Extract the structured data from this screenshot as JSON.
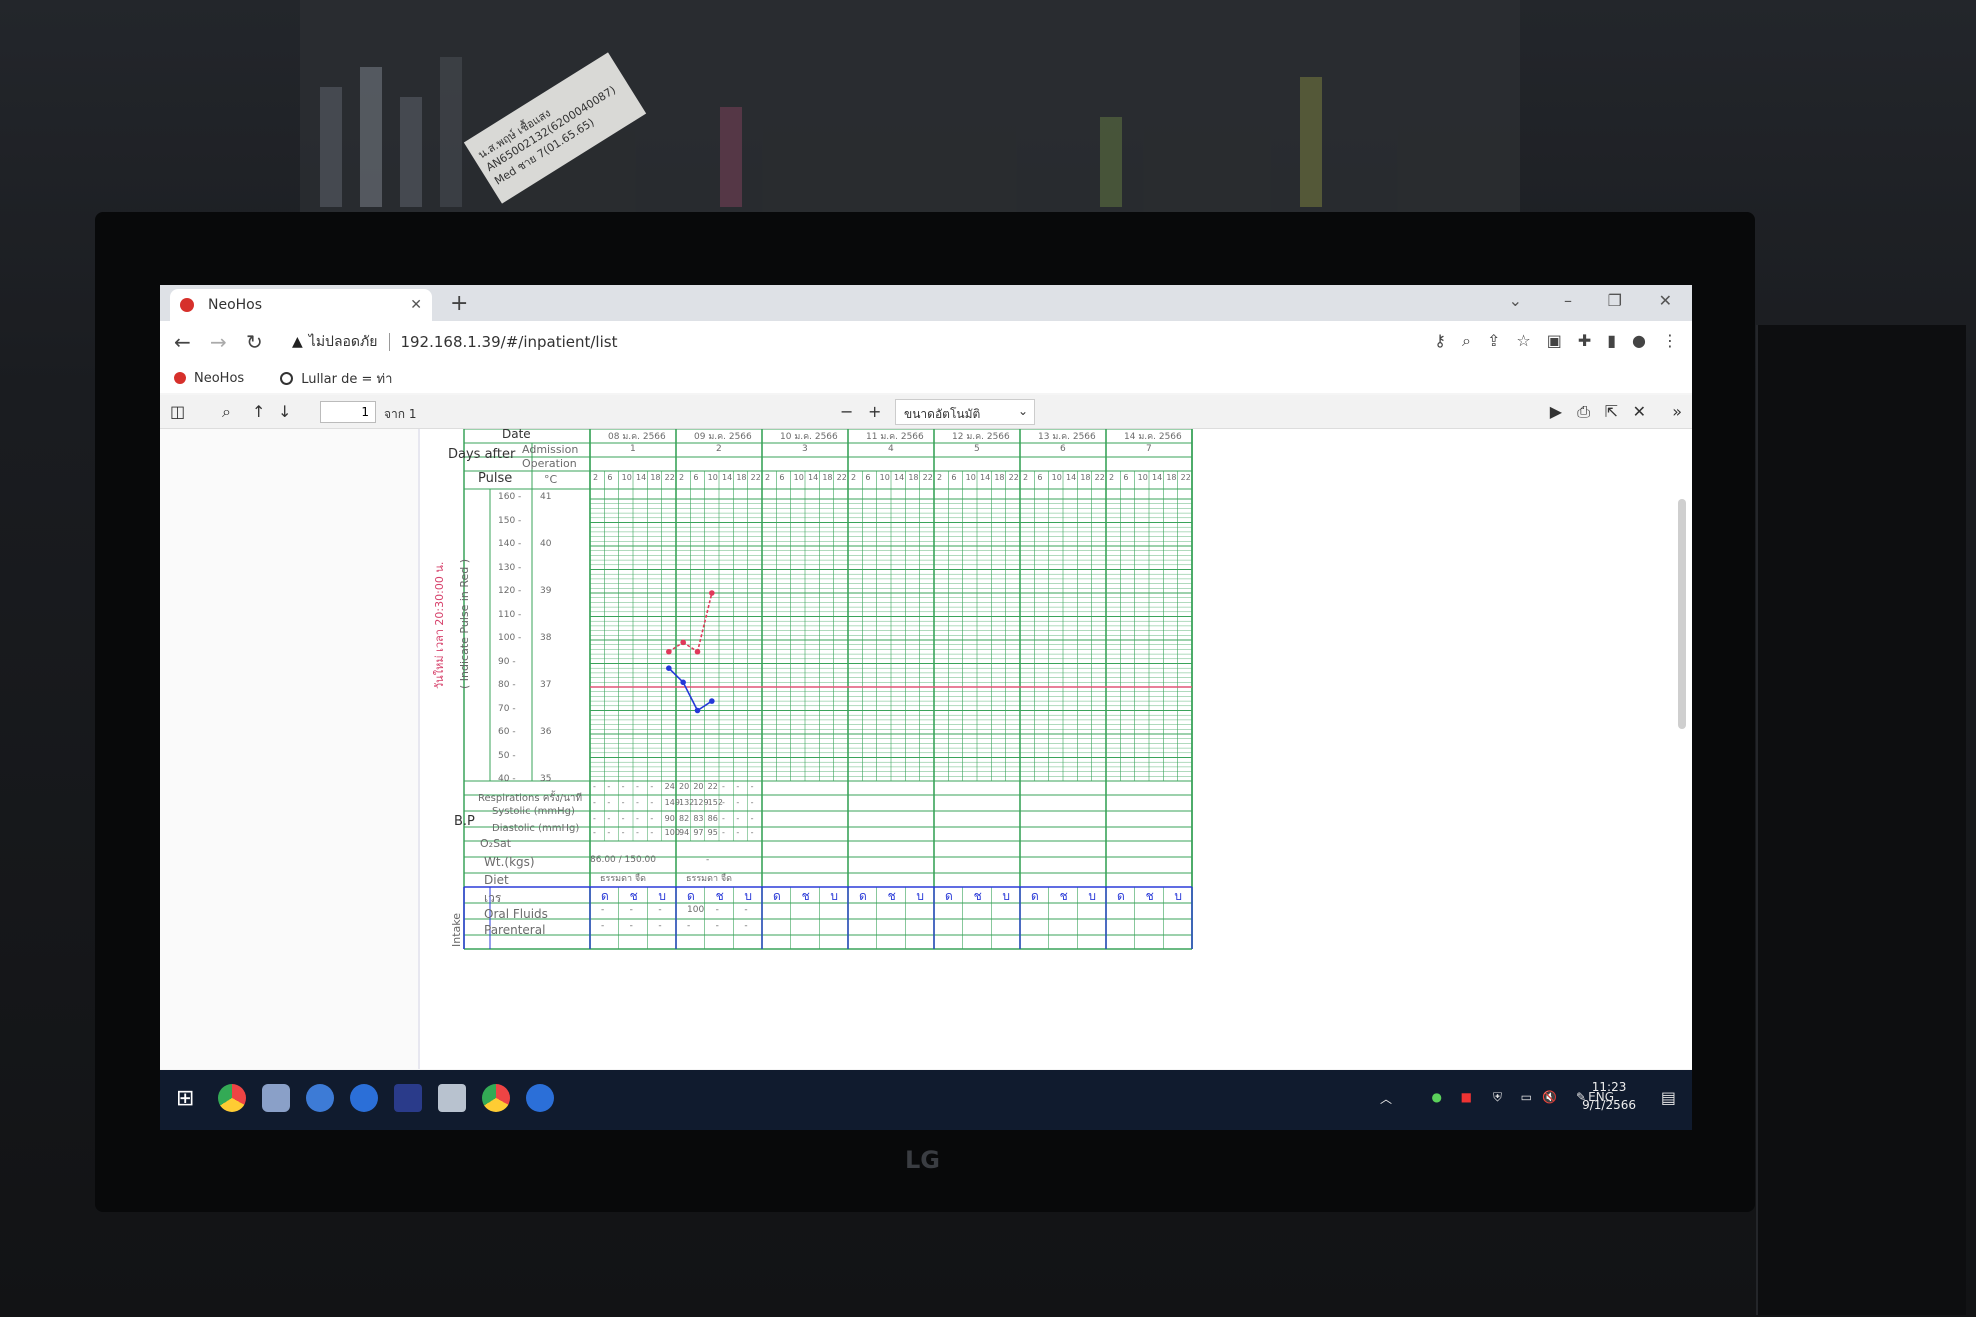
{
  "browser": {
    "tab_title": "NeoHos",
    "new_tab": "+",
    "security_label": "ไม่ปลอดภัย",
    "url": "192.168.1.39/#/inpatient/list",
    "bookmarks": [
      "NeoHos",
      "Lullar de = ท่า"
    ]
  },
  "pdf_toolbar": {
    "page_value": "1",
    "page_count": "จาก 1",
    "zoom_label": "ขนาดอัตโนมัติ"
  },
  "sticky_note": {
    "line1": "น.ส.พฤษ์ เชื้อแสง",
    "line2": "AN65002132(6200040087)",
    "line3": "Med ชาย 7(01.65.65)"
  },
  "chart": {
    "header_date": "Date",
    "days_after": "Days after",
    "admission": "Admission",
    "operation": "Operation",
    "pulse": "Pulse",
    "celsius": "°C",
    "indicate_label": "( Indicate Pulse in Red )",
    "red_side_label": "วันใหม่ เวลา 20:30:00 น.",
    "dates": [
      "08 ม.ค. 2566",
      "09 ม.ค. 2566",
      "10 ม.ค. 2566",
      "11 ม.ค. 2566",
      "12 ม.ค. 2566",
      "13 ม.ค. 2566",
      "14 ม.ค. 2566"
    ],
    "admission_days": [
      "1",
      "2",
      "3",
      "4",
      "5",
      "6",
      "7"
    ],
    "hours": [
      "2",
      "6",
      "10",
      "14",
      "18",
      "22"
    ],
    "pulse_ticks": [
      "160",
      "150",
      "140",
      "130",
      "120",
      "110",
      "100",
      "90",
      "80",
      "70",
      "60",
      "50",
      "40"
    ],
    "temp_ticks": [
      "41",
      "40",
      "39",
      "38",
      "37",
      "36",
      "35"
    ],
    "respirations_label": "Respirations ครั้ง/นาที",
    "bp_label": "B.P",
    "systolic_label": "Systolic (mmHg)",
    "diastolic_label": "Diastolic (mmHg)",
    "o2sat_label": "O₂Sat",
    "wt_label": "Wt.(kgs)",
    "diet_label": "Diet",
    "shift_label": "เวร",
    "oral_fluids_label": "Oral Fluids",
    "parenteral_label": "Parenteral",
    "intake_label": "Intake",
    "shifts": [
      "ด",
      "ช",
      "บ"
    ],
    "respirations": [
      "-",
      "-",
      "-",
      "-",
      "-",
      "24",
      "20",
      "20",
      "22",
      "-",
      "-",
      "-"
    ],
    "systolic": [
      "-",
      "-",
      "-",
      "-",
      "-",
      "149",
      "132",
      "129",
      "152",
      "-",
      "-",
      "-"
    ],
    "diastolic": [
      "-",
      "-",
      "-",
      "-",
      "-",
      "90",
      "82",
      "83",
      "86",
      "-",
      "-",
      "-"
    ],
    "o2sat": [
      "-",
      "-",
      "-",
      "-",
      "-",
      "100",
      "94",
      "97",
      "95",
      "-",
      "-",
      "-"
    ],
    "weight": "86.00 / 150.00",
    "weight_dash": "-",
    "diet_day1": "ธรรมดา จืด",
    "diet_day2": "ธรรมดา จืด",
    "oral_fluids": [
      "-",
      "-",
      "-",
      "100",
      "-",
      "-"
    ],
    "parenteral": [
      "-",
      "-",
      "-",
      "-",
      "-",
      "-"
    ],
    "colors": {
      "grid": "#3aa35a",
      "pulse": "#e0395a",
      "temp": "#2438d8",
      "baseline": "#e05577"
    }
  },
  "chart_data": {
    "type": "line",
    "x": [
      "08 ม.ค. 22",
      "09 ม.ค. 2",
      "09 ม.ค. 6",
      "09 ม.ค. 10"
    ],
    "series": [
      {
        "values": [
          95,
          99,
          95,
          120
        ]
      },
      {
        "values": [
          37.4,
          37.1,
          36.5,
          36.7
        ]
      }
    ],
    "ylim": [
      40,
      160
    ]
  },
  "taskbar": {
    "language": "ENG",
    "time": "11:23",
    "date": "9/1/2566"
  }
}
